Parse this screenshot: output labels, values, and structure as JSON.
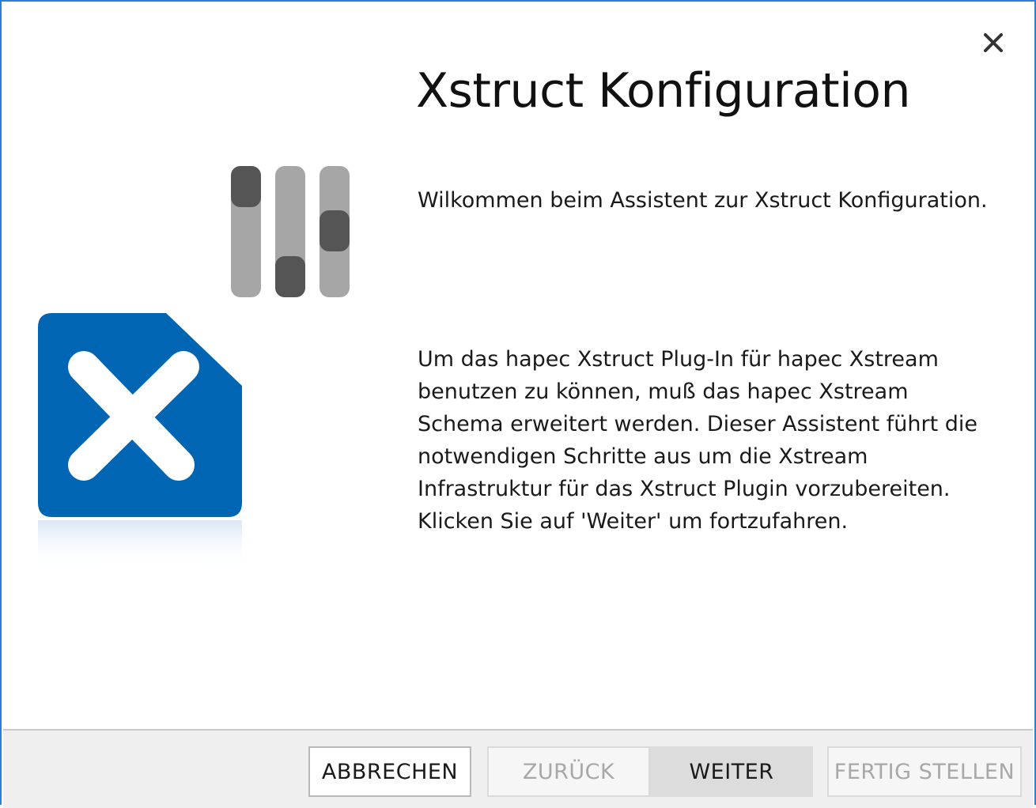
{
  "dialog": {
    "title": "Xstruct Konfiguration",
    "close_icon": "close-icon",
    "welcome_text": "Wilkommen beim Assistent zur Xstruct Konfiguration.",
    "description_lines": [
      "Um das hapec Xstruct Plug-In für hapec Xstream",
      "benutzen zu können, muß das hapec Xstream",
      "Schema erweitert werden. Dieser Assistent führt die",
      "notwendigen Schritte aus um die Xstream",
      "Infrastruktur für das Xstruct Plugin vorzubereiten.",
      "Klicken Sie auf 'Weiter' um fortzufahren."
    ],
    "graphics": {
      "sliders_icon": "settings-sliders-icon",
      "logo_icon": "xstruct-logo-icon",
      "brand_color": "#0066b3"
    }
  },
  "footer": {
    "buttons": {
      "cancel": "ABBRECHEN",
      "back": "ZURÜCK",
      "next": "WEITER",
      "finish": "FERTIG STELLEN"
    }
  }
}
